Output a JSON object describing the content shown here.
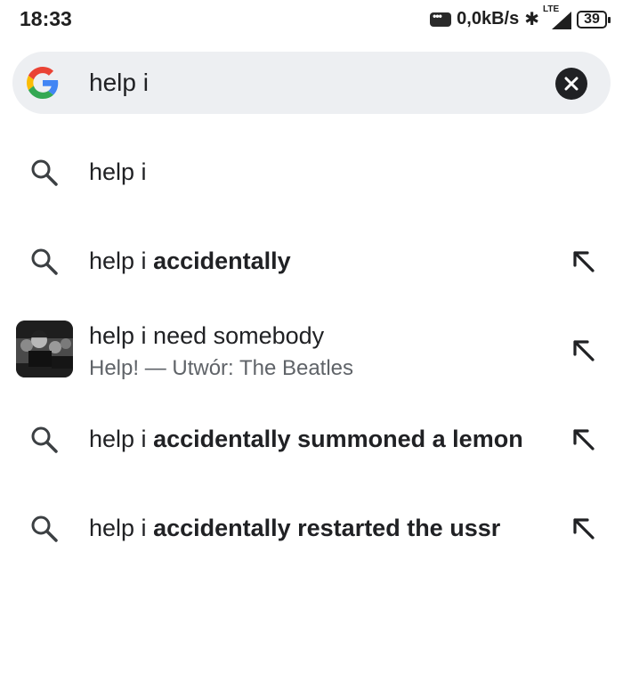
{
  "status": {
    "time": "18:33",
    "net_speed": "0,0kB/s",
    "network": "LTE",
    "battery": "39"
  },
  "search": {
    "query": "help i"
  },
  "suggestions": [
    {
      "plain": "help i",
      "bold": "",
      "icon": "search-icon",
      "has_arrow": false
    },
    {
      "plain": "help i ",
      "bold": "accidentally",
      "icon": "search-icon",
      "has_arrow": true
    },
    {
      "plain": "help i need somebody",
      "bold": "",
      "subtitle": "Help! — Utwór: The Beatles",
      "icon": "beatles-thumbnail",
      "has_arrow": true
    },
    {
      "plain": "help i ",
      "bold": "accidentally summoned a lemon",
      "icon": "search-icon",
      "has_arrow": true
    },
    {
      "plain": "help i ",
      "bold": "accidentally restarted the ussr",
      "icon": "search-icon",
      "has_arrow": true
    }
  ]
}
